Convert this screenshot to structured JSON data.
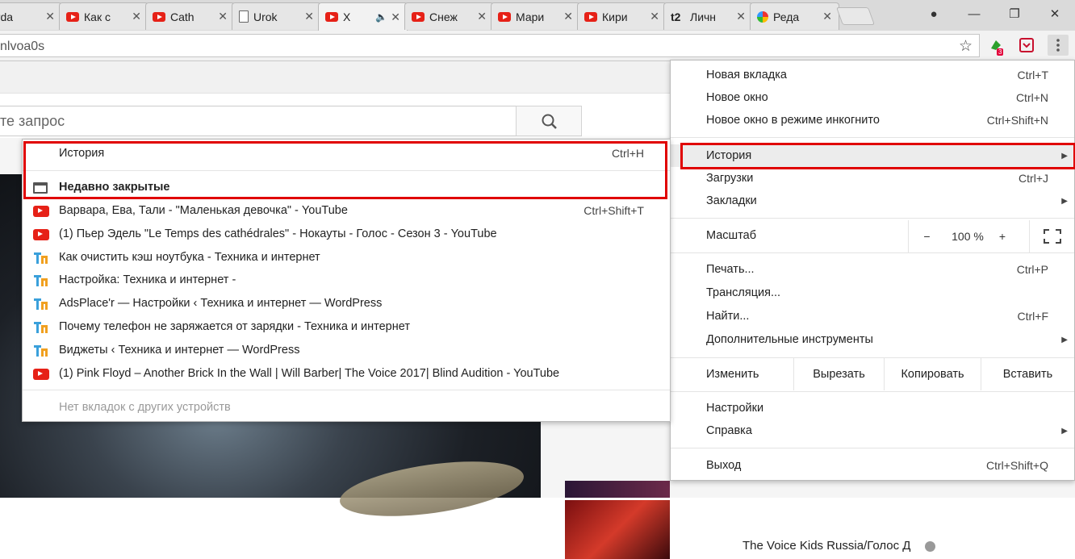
{
  "tabs": [
    {
      "title": "Jorda",
      "icon": "generic-icon"
    },
    {
      "title": "Как с",
      "icon": "youtube-icon"
    },
    {
      "title": "Cath",
      "icon": "youtube-icon"
    },
    {
      "title": "Urok",
      "icon": "document-icon"
    },
    {
      "title": "Х",
      "icon": "youtube-icon",
      "active": true,
      "audio": "🔈"
    },
    {
      "title": "Снеж",
      "icon": "youtube-icon"
    },
    {
      "title": "Мари",
      "icon": "youtube-icon"
    },
    {
      "title": "Кири",
      "icon": "youtube-icon"
    },
    {
      "title": "Личн",
      "icon": "t2-icon"
    },
    {
      "title": "Реда",
      "icon": "pinwheel-icon"
    }
  ],
  "tab_close": "✕",
  "window_controls": {
    "minimize": "—",
    "maximize": "❐",
    "close": "✕"
  },
  "address": {
    "url": "nlvoa0s",
    "star": "☆"
  },
  "extensions": {
    "badge": "3"
  },
  "youtube": {
    "search_placeholder": "те запрос",
    "side_channel": "The Voice Kids Russia/Голос Д"
  },
  "main_menu": {
    "items": [
      {
        "label": "Новая вкладка",
        "shortcut": "Ctrl+T"
      },
      {
        "label": "Новое окно",
        "shortcut": "Ctrl+N"
      },
      {
        "label": "Новое окно в режиме инкогнито",
        "shortcut": "Ctrl+Shift+N"
      },
      {
        "label": "История",
        "shortcut": "",
        "submenu": true
      },
      {
        "label": "Загрузки",
        "shortcut": "Ctrl+J"
      },
      {
        "label": "Закладки",
        "shortcut": "",
        "submenu": true
      },
      {
        "label": "Печать...",
        "shortcut": "Ctrl+P"
      },
      {
        "label": "Трансляция...",
        "shortcut": ""
      },
      {
        "label": "Найти...",
        "shortcut": "Ctrl+F"
      },
      {
        "label": "Дополнительные инструменты",
        "shortcut": "",
        "submenu": true
      },
      {
        "label": "Настройки",
        "shortcut": ""
      },
      {
        "label": "Справка",
        "shortcut": "",
        "submenu": true
      },
      {
        "label": "Выход",
        "shortcut": "Ctrl+Shift+Q"
      }
    ],
    "zoom": {
      "label": "Масштаб",
      "minus": "−",
      "value": "100 %",
      "plus": "+"
    },
    "edit": {
      "label": "Изменить",
      "cut": "Вырезать",
      "copy": "Копировать",
      "paste": "Вставить"
    },
    "arrow": "▶"
  },
  "history_menu": {
    "history": {
      "label": "История",
      "shortcut": "Ctrl+H"
    },
    "recently_closed": "Недавно закрытые",
    "entries": [
      {
        "label": "Варвара, Ева, Тали - \"Маленькая девочка\" - YouTube",
        "icon": "youtube-icon",
        "shortcut": "Ctrl+Shift+T"
      },
      {
        "label": "(1) Пьер Эдель \"Le Temps des cathédrales\" - Нокауты - Голос - Сезон 3 - YouTube",
        "icon": "youtube-icon",
        "shortcut": ""
      },
      {
        "label": "Как очистить кэш ноутбука - Техника и интернет",
        "icon": "site-tp-icon",
        "shortcut": ""
      },
      {
        "label": "Настройка: Техника и интернет -",
        "icon": "site-tp-icon",
        "shortcut": ""
      },
      {
        "label": "AdsPlace'r — Настройки ‹ Техника и интернет — WordPress",
        "icon": "site-tp-icon",
        "shortcut": ""
      },
      {
        "label": "Почему телефон не заряжается от зарядки - Техника и интернет",
        "icon": "site-tp-icon",
        "shortcut": ""
      },
      {
        "label": "Виджеты ‹ Техника и интернет — WordPress",
        "icon": "site-tp-icon",
        "shortcut": ""
      },
      {
        "label": "(1) Pink Floyd – Another Brick In the Wall | Will Barber| The Voice 2017| Blind Audition - YouTube",
        "icon": "youtube-icon",
        "shortcut": ""
      }
    ],
    "no_tabs": "Нет вкладок с других устройств"
  },
  "colors": {
    "highlight": "#e00000",
    "youtube_red": "#e62117",
    "tp_blue": "#3aa0db",
    "tp_orange": "#f0a020"
  }
}
